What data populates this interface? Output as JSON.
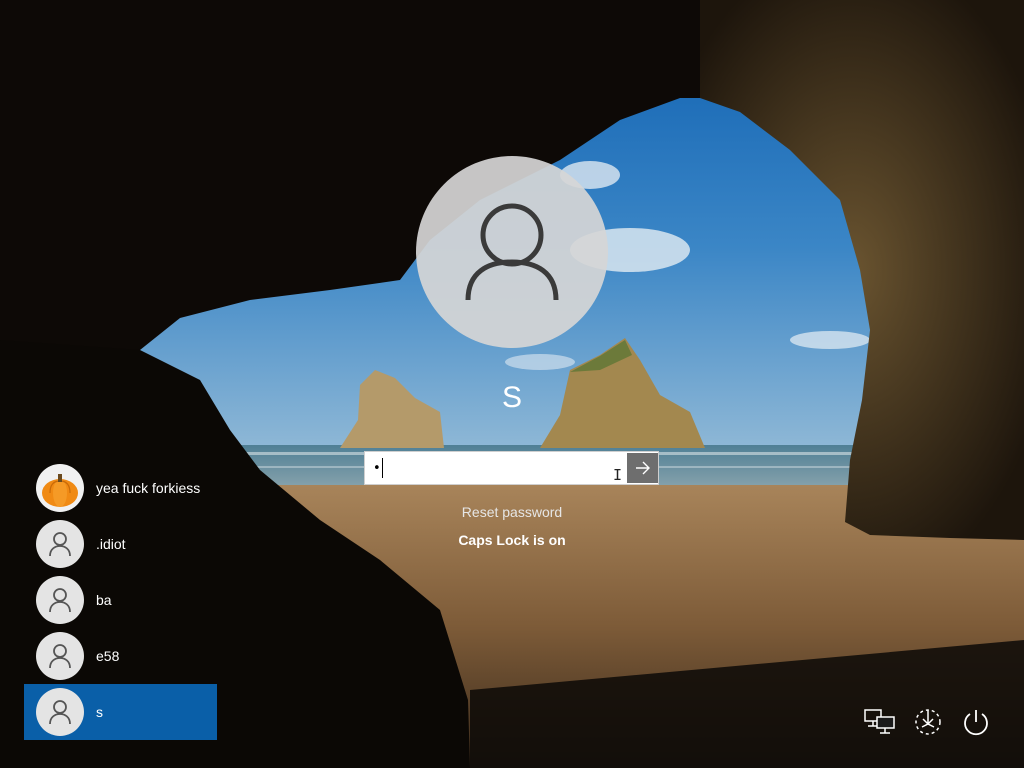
{
  "login": {
    "username": "S",
    "password_masked": "•",
    "reset_password": "Reset password",
    "caps_lock_message": "Caps Lock is on"
  },
  "users": [
    {
      "name": "yea fuck forkiess",
      "avatar": "pumpkin-avatar",
      "selected": false
    },
    {
      "name": ".idiot",
      "avatar": "person-icon",
      "selected": false
    },
    {
      "name": "ba",
      "avatar": "person-icon",
      "selected": false
    },
    {
      "name": "e58",
      "avatar": "person-icon",
      "selected": false
    },
    {
      "name": "s",
      "avatar": "person-icon",
      "selected": true
    }
  ],
  "system_buttons": [
    {
      "name": "network-icon"
    },
    {
      "name": "ease-of-access-icon"
    },
    {
      "name": "power-icon"
    }
  ],
  "colors": {
    "selected_user": "#0a5fa8",
    "submit_button": "#6e6e6e"
  }
}
